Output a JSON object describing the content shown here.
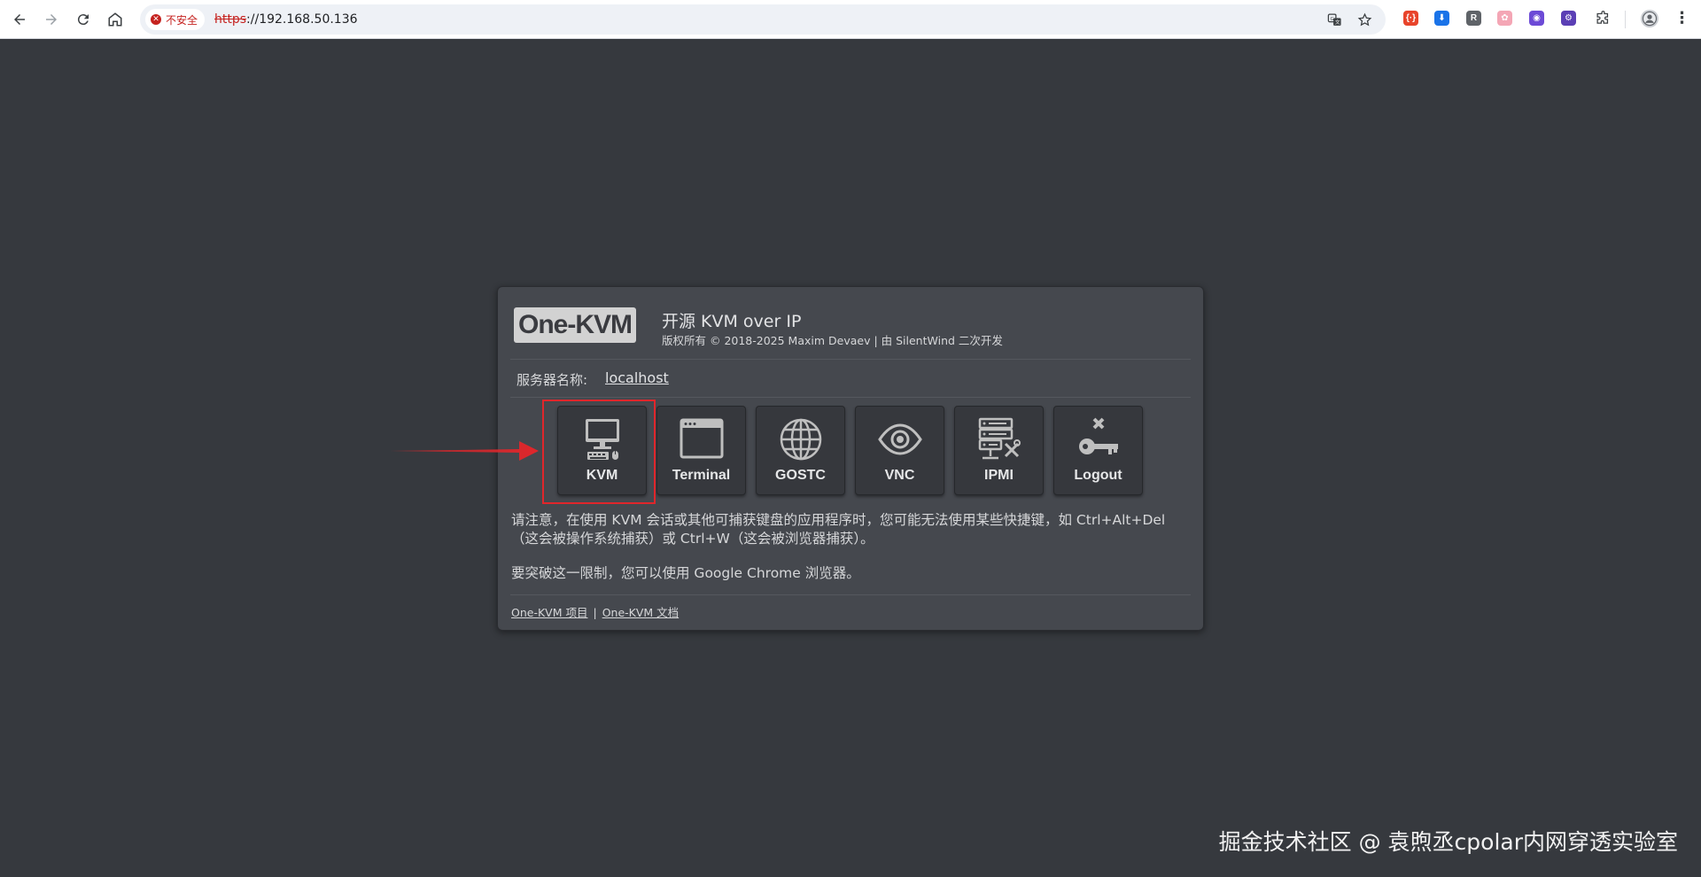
{
  "browser": {
    "security_label": "不安全",
    "url_scheme": "https",
    "url_rest": "://192.168.50.136",
    "extensions": [
      {
        "name": "extension-json",
        "glyph": "{·}",
        "color": "#e8442b"
      },
      {
        "name": "extension-download",
        "glyph": "⬇",
        "color": "#1a73e8"
      },
      {
        "name": "extension-r",
        "glyph": "R",
        "color": "#5f6368"
      },
      {
        "name": "extension-pink",
        "glyph": "✿",
        "color": "#f4a6b5"
      },
      {
        "name": "extension-purple",
        "glyph": "◉",
        "color": "#6c4ad6"
      },
      {
        "name": "extension-gear",
        "glyph": "⚙",
        "color": "#5b3fb5"
      }
    ]
  },
  "card": {
    "logo": "One-KVM",
    "title": "开源 KVM over IP",
    "copyright": "版权所有 © 2018-2025 Maxim Devaev | 由 SilentWind 二次开发",
    "server_label": "服务器名称:",
    "server_name": "localhost",
    "tiles": [
      {
        "label": "KVM",
        "icon": "monitor-keyboard-icon"
      },
      {
        "label": "Terminal",
        "icon": "terminal-window-icon"
      },
      {
        "label": "GOSTC",
        "icon": "globe-icon"
      },
      {
        "label": "VNC",
        "icon": "eye-icon"
      },
      {
        "label": "IPMI",
        "icon": "server-tools-icon"
      },
      {
        "label": "Logout",
        "icon": "key-x-icon"
      }
    ],
    "notice_line1": "请注意，在使用 KVM 会话或其他可捕获键盘的应用程序时，您可能无法使用某些快捷键，如 Ctrl+Alt+Del",
    "notice_line2": "（这会被操作系统捕获）或 Ctrl+W（这会被浏览器捕获）。",
    "notice_tip": "要突破这一限制，您可以使用 Google Chrome 浏览器。",
    "footer_project": "One-KVM 项目",
    "footer_sep": "|",
    "footer_docs": "One-KVM 文档"
  },
  "watermark": "掘金技术社区 @ 袁煦丞cpolar内网穿透实验室",
  "colors": {
    "page_bg": "#36393e",
    "card_bg": "#45484e",
    "tile_bg": "#36383d",
    "highlight": "#e0262b"
  }
}
